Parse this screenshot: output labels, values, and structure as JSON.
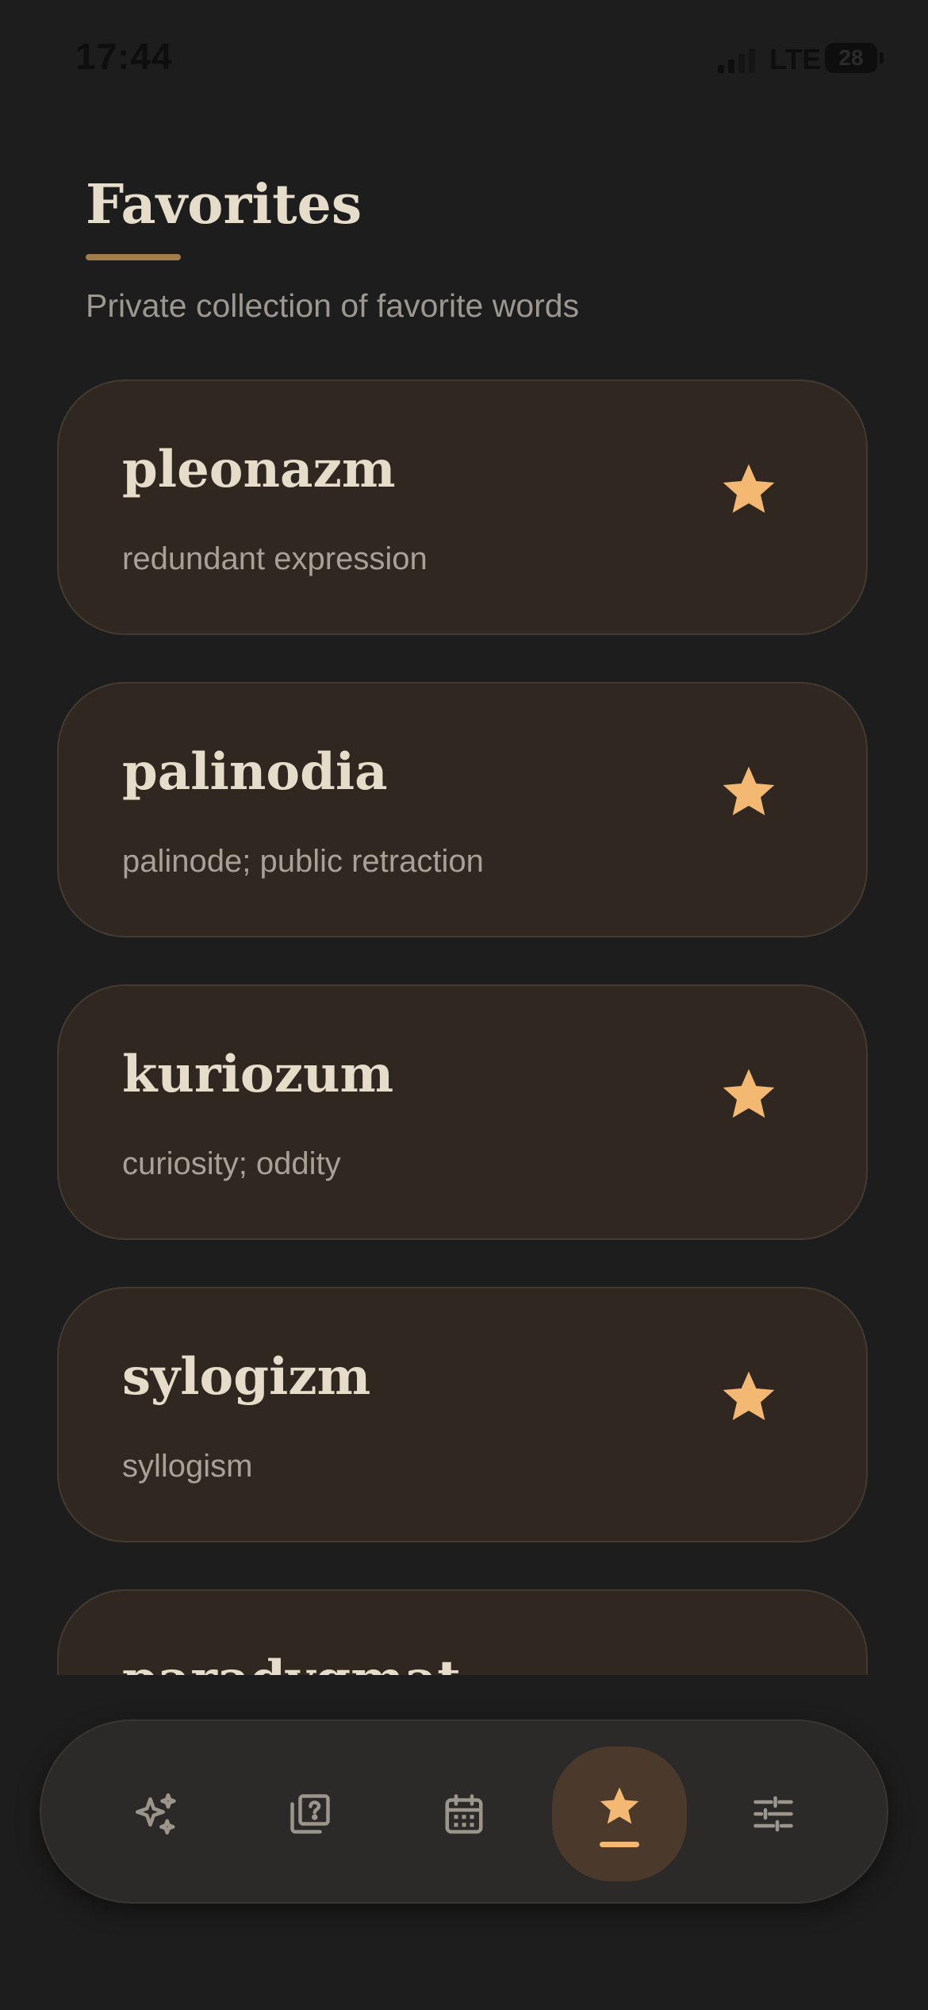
{
  "status_bar": {
    "time": "17:44",
    "network": "LTE",
    "battery": "28"
  },
  "header": {
    "title": "Favorites",
    "subtitle": "Private collection of favorite words"
  },
  "favorites": [
    {
      "word": "pleonazm",
      "meaning": "redundant expression",
      "favorited": true
    },
    {
      "word": "palinodia",
      "meaning": "palinode; public retraction",
      "favorited": true
    },
    {
      "word": "kuriozum",
      "meaning": "curiosity; oddity",
      "favorited": true
    },
    {
      "word": "sylogizm",
      "meaning": "syllogism",
      "favorited": true
    },
    {
      "word": "paradygmat",
      "meaning": "",
      "favorited": true
    }
  ],
  "tab_bar": {
    "tabs": [
      {
        "icon": "sparkles-icon"
      },
      {
        "icon": "quiz-icon"
      },
      {
        "icon": "calendar-icon"
      },
      {
        "icon": "star-icon",
        "active": true
      },
      {
        "icon": "sliders-icon"
      }
    ]
  },
  "colors": {
    "accent": "#f3b872",
    "background": "#1d1d1d",
    "card": "#302820"
  }
}
